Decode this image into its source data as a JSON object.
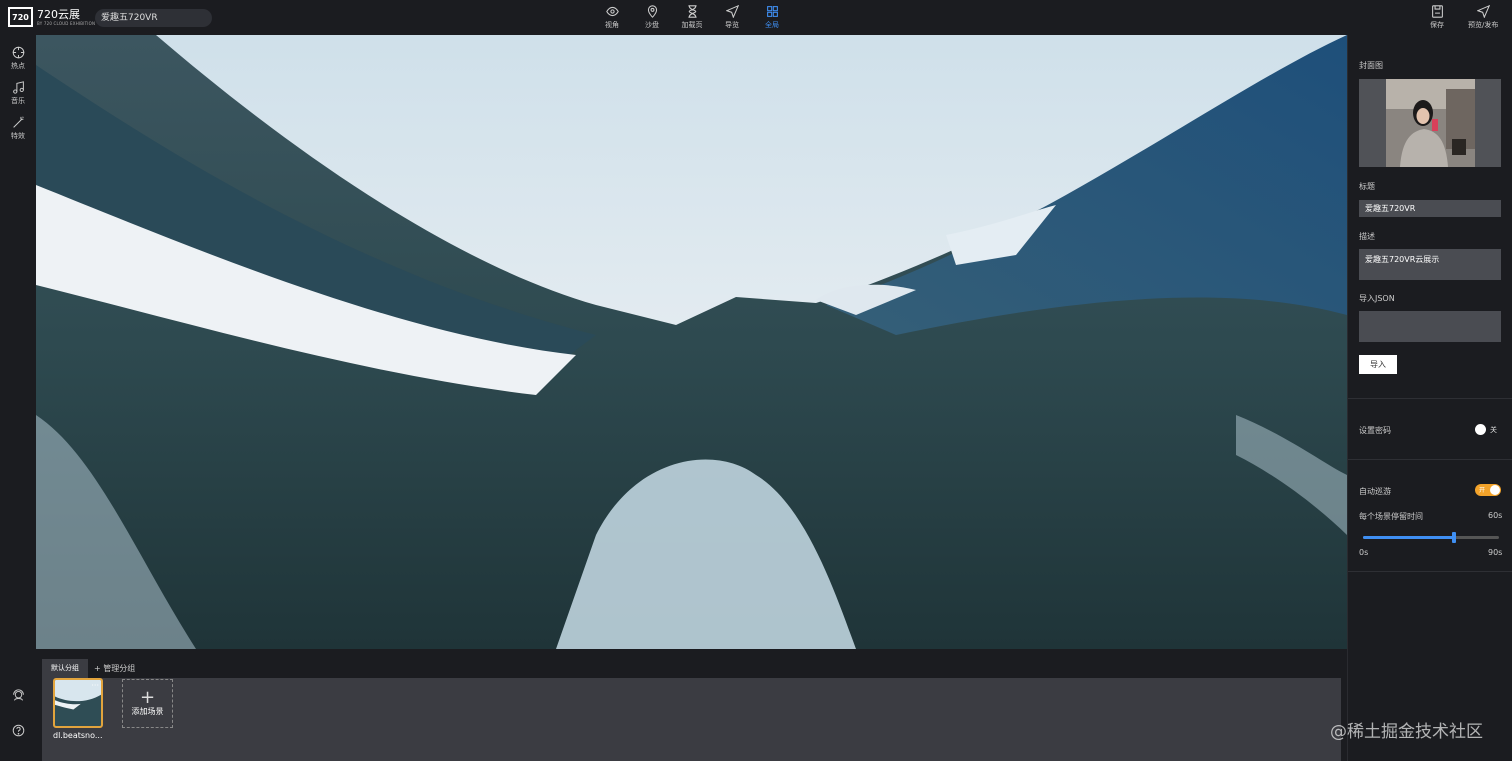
{
  "app": {
    "logo_mark": "720",
    "logo_name": "720云展",
    "logo_sub": "BY 720 CLOUD EXHIBITION"
  },
  "title_input": {
    "value": "爱趣五720VR"
  },
  "topnav": [
    {
      "label": "视角",
      "icon": "eye-icon"
    },
    {
      "label": "沙盘",
      "icon": "map-pin-icon"
    },
    {
      "label": "加载页",
      "icon": "hourglass-icon"
    },
    {
      "label": "导览",
      "icon": "navigation-icon"
    },
    {
      "label": "全局",
      "icon": "grid-icon",
      "active": true
    }
  ],
  "top_actions": {
    "save": "保存",
    "preview": "预览/发布"
  },
  "sidebar": {
    "items": [
      {
        "label": "热点",
        "icon": "crosshair-icon"
      },
      {
        "label": "音乐",
        "icon": "music-icon"
      },
      {
        "label": "特效",
        "icon": "magic-wand-icon"
      }
    ],
    "bottom_icons": [
      "support-icon",
      "help-icon"
    ]
  },
  "bottom": {
    "tab_default": "默认分组",
    "tab_manage": "管理分组",
    "scenes": [
      {
        "name": "dl.beatsno..."
      }
    ],
    "add_scene": "添加场景"
  },
  "right_panel": {
    "cover_label": "封面图",
    "title_label": "标题",
    "title_value": "爱趣五720VR",
    "desc_label": "描述",
    "desc_value": "爱趣五720VR云展示",
    "json_label": "导入JSON",
    "json_value": "",
    "import_button": "导入",
    "password_label": "设置密码",
    "password_toggle": "关",
    "autotour_label": "自动巡游",
    "autotour_toggle": "开",
    "stay_label": "每个场景停留时间",
    "stay_value": "60s",
    "range_min": "0s",
    "range_max": "90s",
    "stay_fraction": 0.667
  },
  "colors": {
    "accent": "#3f8ff3",
    "toggle_on": "#f3a32a",
    "selected_border": "#e2a43d"
  },
  "watermark": "@稀土掘金技术社区"
}
